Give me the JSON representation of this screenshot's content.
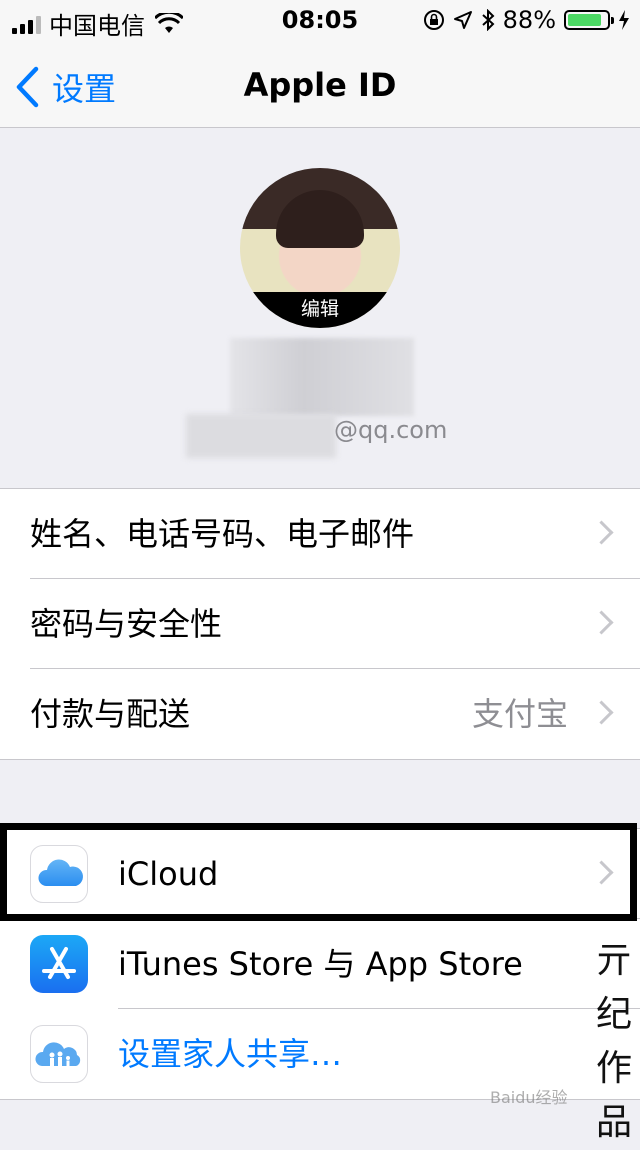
{
  "status_bar": {
    "carrier": "中国电信",
    "time": "08:05",
    "battery_percent": "88%",
    "battery_level": 0.88,
    "icons": [
      "signal-icon",
      "wifi-icon",
      "orientation-lock-icon",
      "location-icon",
      "bluetooth-icon",
      "battery-icon",
      "charging-icon"
    ]
  },
  "nav": {
    "back_label": "设置",
    "title": "Apple ID"
  },
  "profile": {
    "edit_label": "编辑",
    "email_suffix": "@qq.com"
  },
  "account_rows": [
    {
      "label": "姓名、电话号码、电子邮件",
      "detail": ""
    },
    {
      "label": "密码与安全性",
      "detail": ""
    },
    {
      "label": "付款与配送",
      "detail": "支付宝"
    }
  ],
  "service_rows": [
    {
      "label": "iCloud",
      "icon": "icloud-icon"
    },
    {
      "label": "iTunes Store 与 App Store",
      "icon": "app-store-icon"
    },
    {
      "label": "设置家人共享…",
      "icon": "family-sharing-icon"
    }
  ],
  "watermark": {
    "chars": [
      "亓",
      "纪",
      "作",
      "品"
    ],
    "logo": "Baidu经验"
  },
  "colors": {
    "accent": "#007aff",
    "battery": "#4cd964",
    "background": "#efeff4"
  }
}
